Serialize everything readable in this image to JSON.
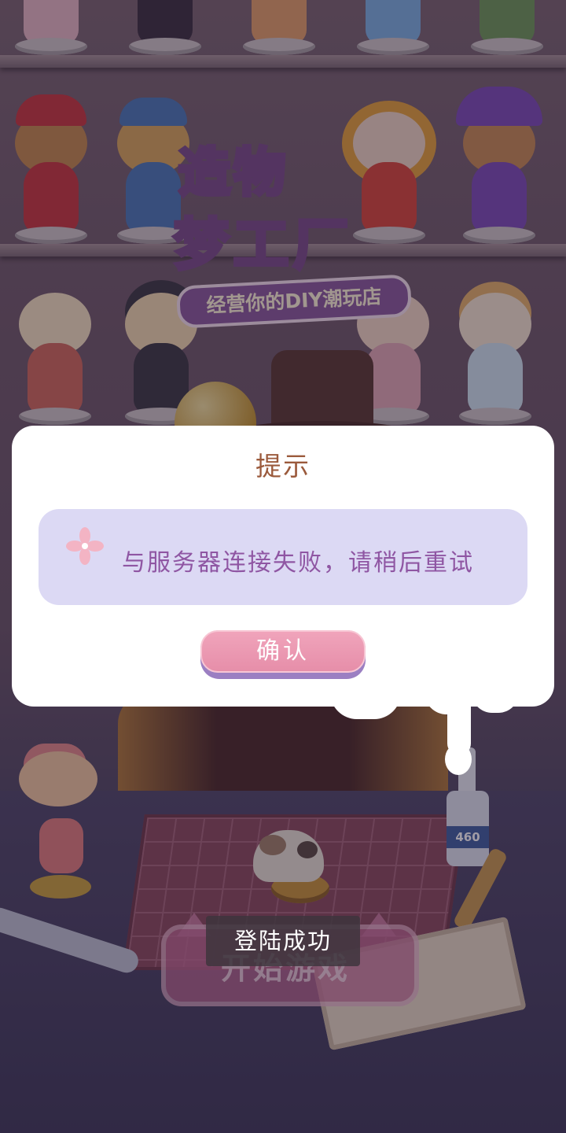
{
  "game": {
    "logo_line1": "造物",
    "logo_line2": "梦工厂",
    "logo_tagline": "经营你的DIY潮玩店",
    "start_button_label": "开始游戏",
    "glue_label": "460"
  },
  "dialog": {
    "title": "提示",
    "message": "与服务器连接失败，请稍后重试",
    "confirm_label": "确认",
    "icon": "flower-icon"
  },
  "toast": {
    "text": "登陆成功"
  },
  "colors": {
    "dialog_title": "#9b5a3c",
    "message_text": "#8f56a3",
    "message_box": "#dcd9f4",
    "confirm_button": "#e68ea9"
  }
}
